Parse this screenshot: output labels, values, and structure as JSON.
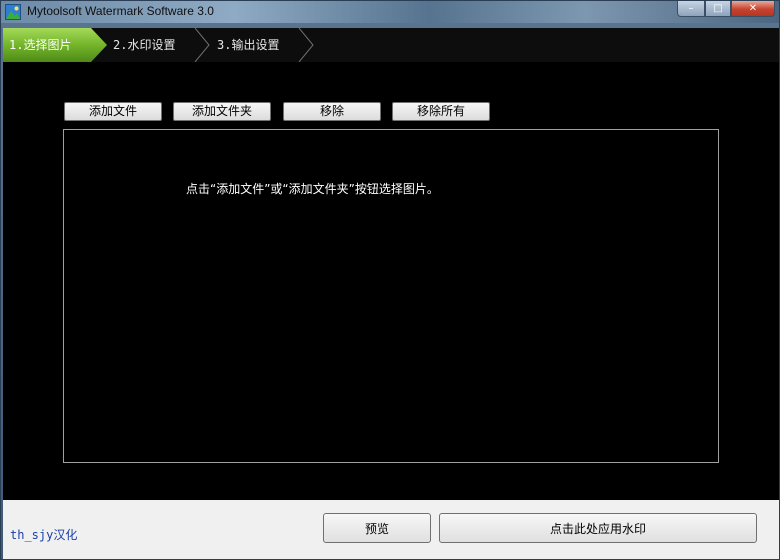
{
  "window": {
    "title": "Mytoolsoft Watermark Software 3.0",
    "icon": "app-icon",
    "controls": {
      "minimize": "–",
      "maximize": "□",
      "close": "✕"
    }
  },
  "steps": [
    {
      "label": "1.选择图片",
      "active": true
    },
    {
      "label": "2.水印设置",
      "active": false
    },
    {
      "label": "3.输出设置",
      "active": false
    }
  ],
  "toolbar": {
    "add_file": "添加文件",
    "add_folder": "添加文件夹",
    "remove": "移除",
    "remove_all": "移除所有"
  },
  "file_list": {
    "hint": "点击“添加文件”或“添加文件夹”按钮选择图片。"
  },
  "footer": {
    "credit": "th_sjy汉化",
    "preview": "预览",
    "apply": "点击此处应用水印"
  },
  "colors": {
    "accent": "#7cba2a",
    "content_bg": "#000000",
    "credit_text": "#1a3ea8"
  }
}
